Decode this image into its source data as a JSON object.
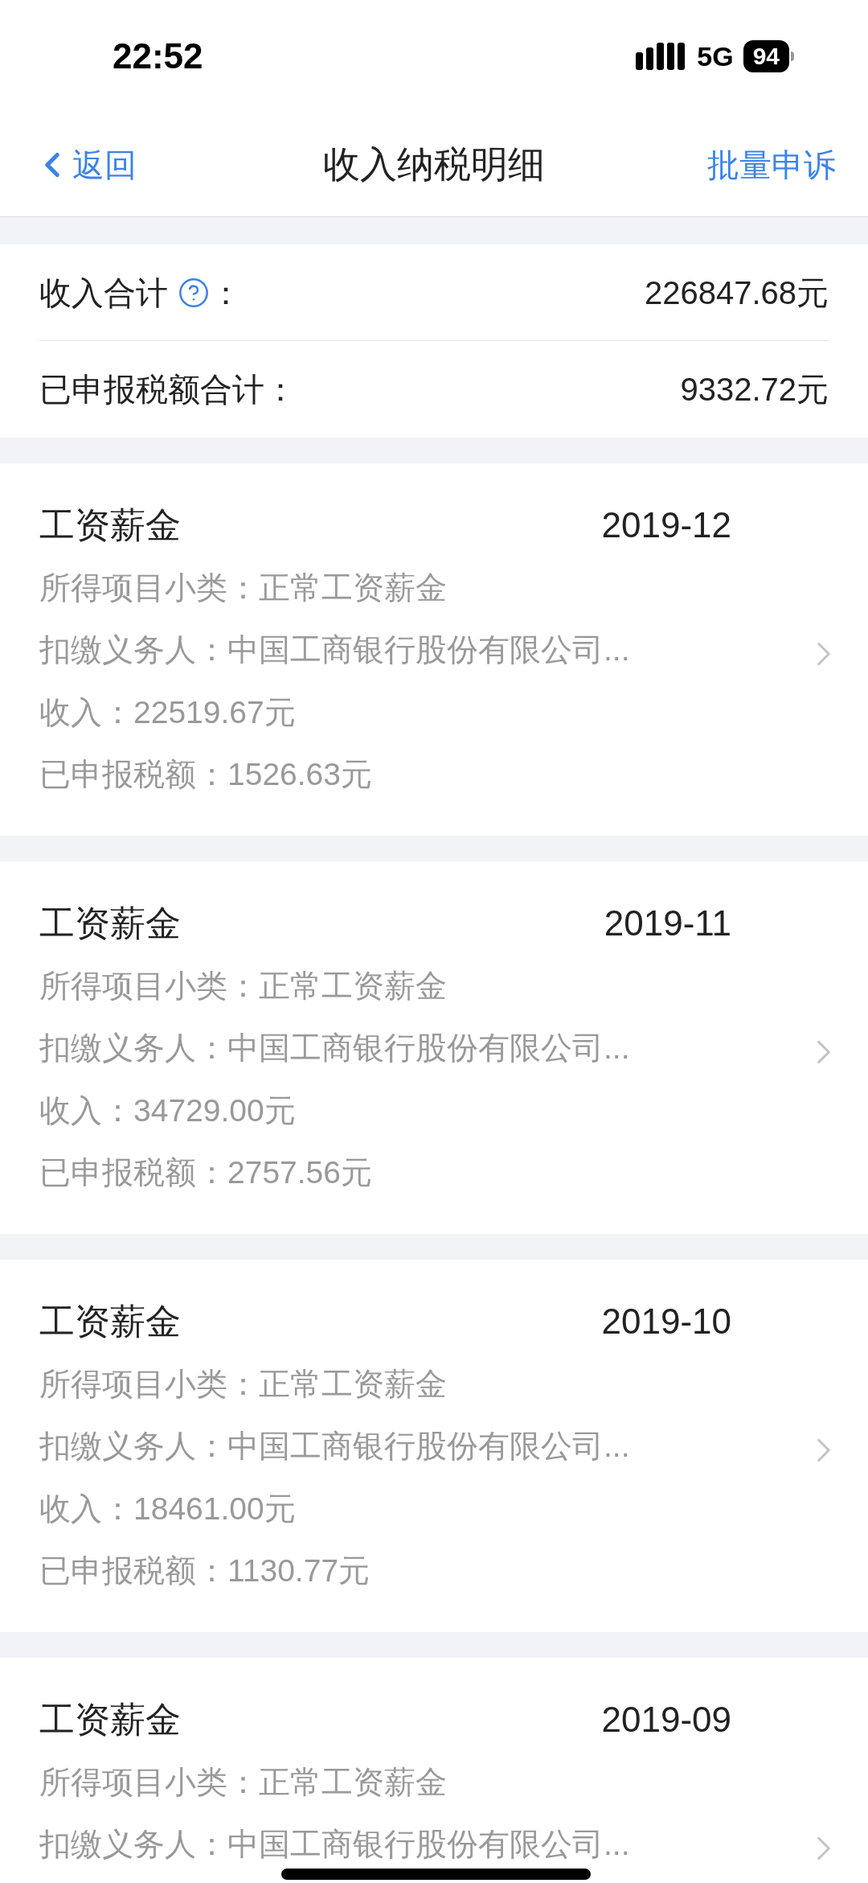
{
  "status_bar": {
    "time": "22:52",
    "network": "5G",
    "battery": "94"
  },
  "nav": {
    "back": "返回",
    "title": "收入纳税明细",
    "action": "批量申诉"
  },
  "summary": [
    {
      "label": "收入合计",
      "help": true,
      "colon": "：",
      "value": "226847.68元"
    },
    {
      "label": "已申报税额合计：",
      "help": false,
      "value": "9332.72元"
    }
  ],
  "records": [
    {
      "category": "工资薪金",
      "period": "2019-12",
      "lines": [
        "所得项目小类：正常工资薪金",
        "扣缴义务人：中国工商银行股份有限公司...",
        "收入：22519.67元",
        "已申报税额：1526.63元"
      ]
    },
    {
      "category": "工资薪金",
      "period": "2019-11",
      "lines": [
        "所得项目小类：正常工资薪金",
        "扣缴义务人：中国工商银行股份有限公司...",
        "收入：34729.00元",
        "已申报税额：2757.56元"
      ]
    },
    {
      "category": "工资薪金",
      "period": "2019-10",
      "lines": [
        "所得项目小类：正常工资薪金",
        "扣缴义务人：中国工商银行股份有限公司...",
        "收入：18461.00元",
        "已申报税额：1130.77元"
      ]
    },
    {
      "category": "工资薪金",
      "period": "2019-09",
      "lines": [
        "所得项目小类：正常工资薪金",
        "扣缴义务人：中国工商银行股份有限公司..."
      ]
    }
  ]
}
